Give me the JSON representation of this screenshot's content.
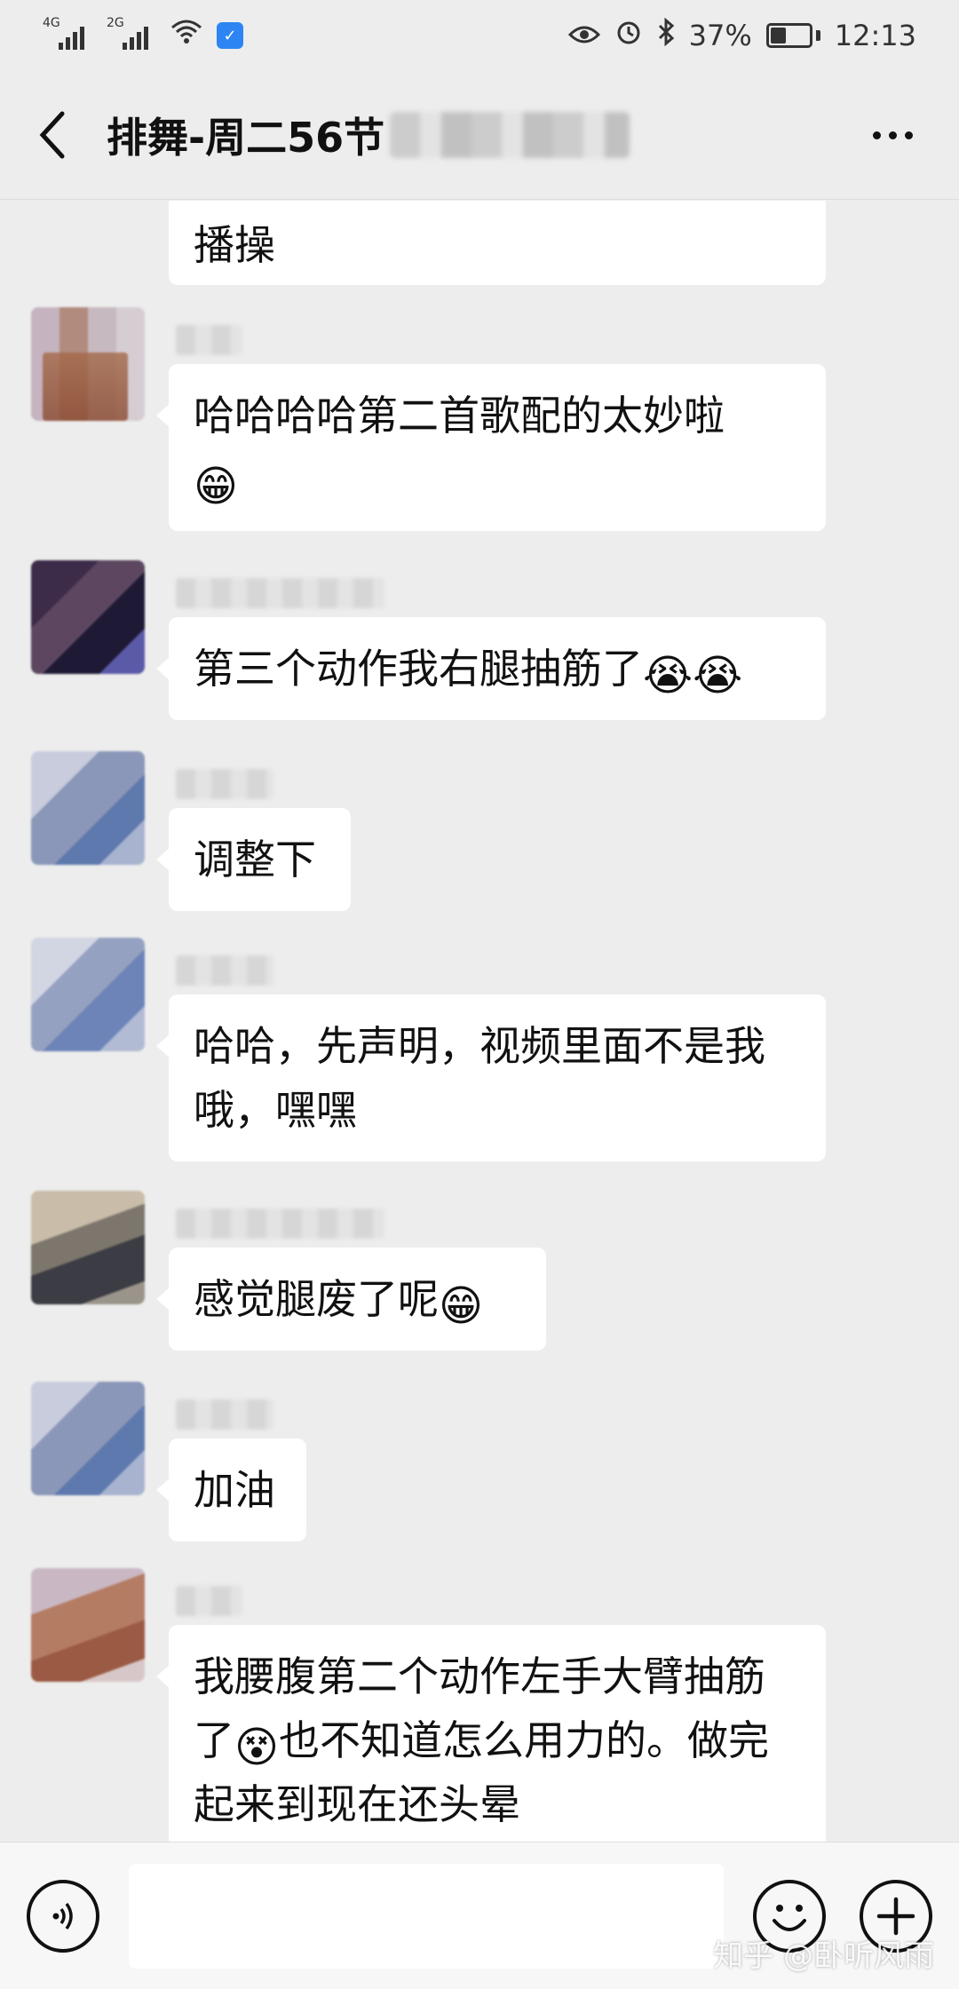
{
  "status_bar": {
    "signal1": "4G",
    "signal2": "2G",
    "battery": "37%",
    "time": "12:13",
    "battery_level": 0.37
  },
  "header": {
    "title": "排舞-周二56节"
  },
  "messages": [
    {
      "text": "播操",
      "emoji": ""
    },
    {
      "text": "哈哈哈哈第二首歌配的太妙啦",
      "emoji": "😁"
    },
    {
      "text": "第三个动作我右腿抽筋了",
      "emoji": "😭😭"
    },
    {
      "text": "调整下",
      "emoji": ""
    },
    {
      "text": "哈哈，先声明，视频里面不是我哦，嘿嘿",
      "emoji": ""
    },
    {
      "text": "感觉腿废了呢",
      "emoji": "😁"
    },
    {
      "text": "加油",
      "emoji": ""
    },
    {
      "text_a": "我腰腹第二个动作左手大臂抽筋了",
      "emoji": "😵",
      "text_b": "也不知道怎么用力的。做完起来到现在还头晕"
    }
  ],
  "icons": {
    "back": "back-arrow-icon",
    "more": "more-dots-icon",
    "voice": "voice-icon",
    "emoji": "emoji-icon",
    "plus": "plus-icon",
    "wifi": "wifi-icon",
    "eye": "eye-icon",
    "alarm": "alarm-icon",
    "bluetooth": "bluetooth-icon"
  },
  "watermark": "知乎 @卧听风雨"
}
